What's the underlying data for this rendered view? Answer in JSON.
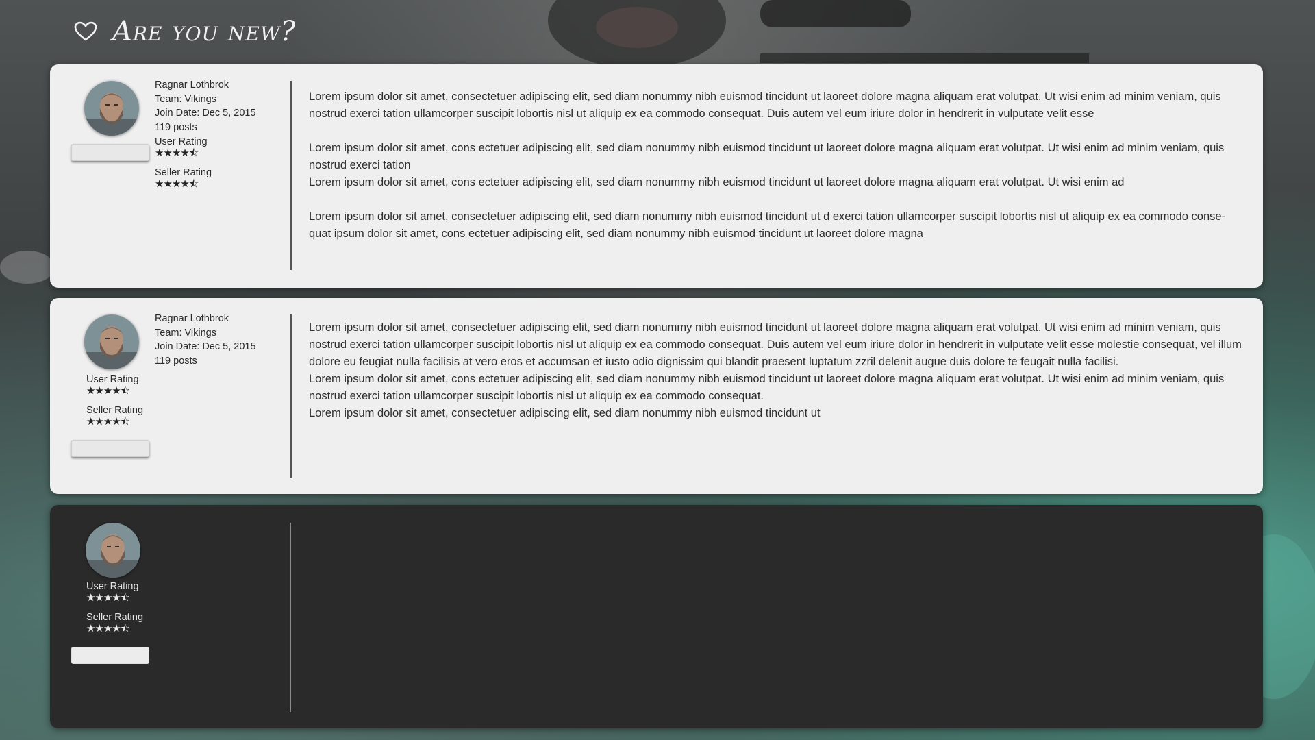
{
  "header": {
    "title": "Are you new?",
    "icon": "heart-outline-icon"
  },
  "colors": {
    "card_light": "#efefef",
    "card_dark": "#2a2a2a",
    "accent_bg": "#52aa96"
  },
  "posts": [
    {
      "author": "Ragnar Lothbrok",
      "team": "Team: Vikings",
      "join_date": "Join Date: Dec 5, 2015",
      "posts": "119 posts",
      "user_rating_label": "User Rating",
      "user_rating": 4.5,
      "seller_rating_label": "Seller Rating",
      "seller_rating": 4.5,
      "paragraphs": [
        {
          "text": "Lorem ipsum dolor sit amet, consectetuer adipiscing elit, sed diam nonummy nibh euismod tincidunt ut laoreet dolore magna aliquam erat volutpat. Ut wisi enim ad minim veniam, quis nostrud exerci tation ullamcorper suscipit lobortis nisl ut aliquip ex ea commodo consequat. Duis autem vel eum iriure dolor in hendrerit in vulputate velit esse"
        },
        {
          "text": "Lorem ipsum dolor sit amet, cons ectetuer adipiscing elit, sed diam nonummy nibh euismod tincidunt ut laoreet dolore magna aliquam erat volutpat. Ut wisi enim ad minim veniam, quis nostrud exerci tation"
        },
        {
          "text": "Lorem ipsum dolor sit amet, cons ectetuer adipiscing elit, sed diam nonummy nibh euismod tincidunt ut laoreet dolore magna aliquam erat volutpat. Ut wisi enim ad"
        },
        {
          "text": "Lorem ipsum dolor sit amet, consectetuer adipiscing elit, sed diam nonummy nibh euismod tincidunt ut d exerci tation ullamcorper suscipit lobortis nisl ut aliquip ex ea commodo conse-quat ipsum dolor sit amet, cons ectetuer adipiscing elit, sed diam nonummy nibh euismod tincidunt ut laoreet dolore magna"
        }
      ]
    },
    {
      "author": "Ragnar Lothbrok",
      "team": "Team: Vikings",
      "join_date": "Join Date: Dec 5, 2015",
      "posts": "119 posts",
      "user_rating_label": "User Rating",
      "user_rating": 4.5,
      "seller_rating_label": "Seller Rating",
      "seller_rating": 4.5,
      "paragraphs": [
        {
          "text": "Lorem ipsum dolor sit amet, consectetuer adipiscing elit, sed diam nonummy nibh euismod tincidunt ut laoreet dolore magna aliquam erat volutpat. Ut wisi enim ad minim veniam, quis nostrud exerci tation ullamcorper suscipit lobortis nisl ut aliquip ex ea commodo consequat. Duis autem vel eum iriure dolor in hendrerit in vulputate velit esse molestie consequat, vel illum dolore eu feugiat nulla facilisis at vero eros et accumsan et iusto odio dignissim qui blandit praesent luptatum zzril delenit augue duis dolore te feugait nulla facilisi."
        },
        {
          "text": "Lorem ipsum dolor sit amet, cons ectetuer adipiscing elit, sed diam nonummy nibh euismod tincidunt ut laoreet dolore magna aliquam erat volutpat. Ut wisi enim ad minim veniam, quis nostrud exerci tation ullamcorper suscipit lobortis nisl ut aliquip ex ea commodo consequat."
        },
        {
          "text": "Lorem ipsum dolor sit amet, consectetuer adipiscing elit, sed diam nonummy nibh euismod tincidunt ut"
        }
      ]
    },
    {
      "user_rating_label": "User Rating",
      "user_rating": 4.5,
      "seller_rating_label": "Seller Rating",
      "seller_rating": 4.5
    }
  ]
}
